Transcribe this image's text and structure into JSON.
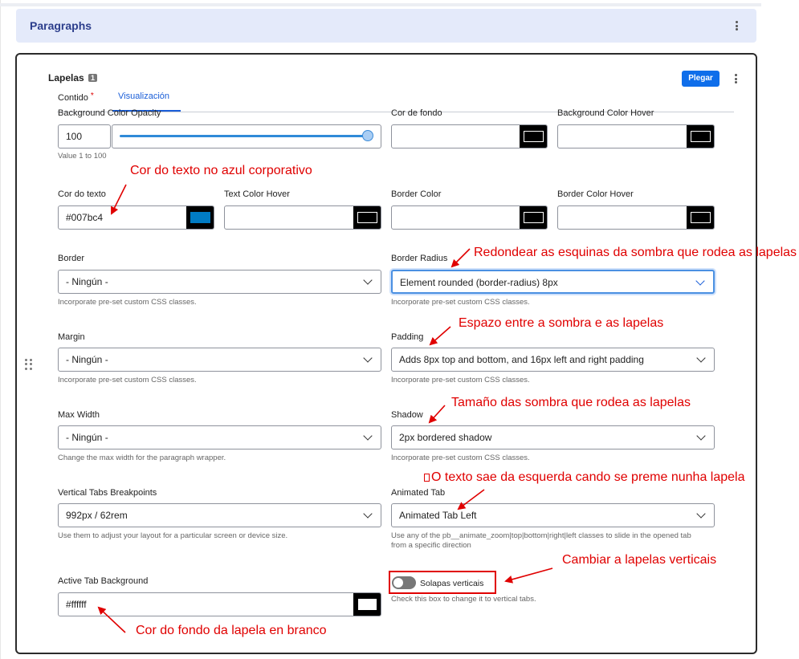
{
  "paragraphs_header": {
    "title": "Paragraphs"
  },
  "component": {
    "title": "Lapelas",
    "badge": "1",
    "collapse_button": "Plegar"
  },
  "tabs": [
    {
      "label": "Contido",
      "required": "*"
    },
    {
      "label": "Visualización"
    }
  ],
  "fields": {
    "bg_opacity": {
      "label": "Background Color Opacity",
      "value": "100",
      "slider_percent": 100,
      "description": "Value 1 to 100"
    },
    "bg_color": {
      "label": "Cor de fondo",
      "value": "",
      "swatch": "#000000"
    },
    "bg_color_hover": {
      "label": "Background Color Hover",
      "value": "",
      "swatch": "#000000"
    },
    "text_color": {
      "label": "Cor do texto",
      "value": "#007bc4",
      "swatch": "#007bc4"
    },
    "text_color_hover": {
      "label": "Text Color Hover",
      "value": "",
      "swatch": "#000000"
    },
    "border_color": {
      "label": "Border Color",
      "value": "",
      "swatch": "#000000"
    },
    "border_color_hover": {
      "label": "Border Color Hover",
      "value": "",
      "swatch": "#000000"
    },
    "border": {
      "label": "Border",
      "value": "- Ningún -",
      "description": "Incorporate pre-set custom CSS classes."
    },
    "border_radius": {
      "label": "Border Radius",
      "value": "Element rounded (border-radius) 8px",
      "description": "Incorporate pre-set custom CSS classes."
    },
    "margin": {
      "label": "Margin",
      "value": "- Ningún -",
      "description": "Incorporate pre-set custom CSS classes."
    },
    "padding": {
      "label": "Padding",
      "value": "Adds 8px top and bottom, and 16px left and right padding",
      "description": "Incorporate pre-set custom CSS classes."
    },
    "max_width": {
      "label": "Max Width",
      "value": "- Ningún -",
      "description": "Change the max width for the paragraph wrapper."
    },
    "shadow": {
      "label": "Shadow",
      "value": "2px bordered shadow",
      "description": "Incorporate pre-set custom CSS classes."
    },
    "vertical_breakpoints": {
      "label": "Vertical Tabs Breakpoints",
      "value": "992px / 62rem",
      "description": "Use them to adjust your layout for a particular screen or device size."
    },
    "animated_tab": {
      "label": "Animated Tab",
      "value": "Animated Tab Left",
      "description_1": "Use any of the pb__animate_zoom|top|bottom|right|left classes to slide in the opened tab",
      "description_2": "from a specific direction"
    },
    "active_tab_bg": {
      "label": "Active Tab Background",
      "value": "#ffffff",
      "swatch": "#ffffff"
    },
    "vertical_tabs": {
      "label": "Solapas verticais",
      "checked": false,
      "description": "Check this box to change it to vertical tabs."
    }
  },
  "annotations": {
    "text_color": "Cor do texto no azul corporativo",
    "border_radius": "Redondear as esquinas da sombra que rodea as lapelas",
    "padding": "Espazo entre a sombra e as lapelas",
    "shadow": "Tamaño das sombra que rodea as lapelas",
    "animated": "O texto sae da esquerda cando se preme nunha lapela",
    "vertical": "Cambiar a lapelas verticais",
    "active_bg": "Cor do fondo da lapela en branco"
  },
  "colors": {
    "annotation": "#e00000",
    "primary": "#0f6eea",
    "header_bg": "#e4eafa",
    "accent": "#1a5ed8"
  }
}
